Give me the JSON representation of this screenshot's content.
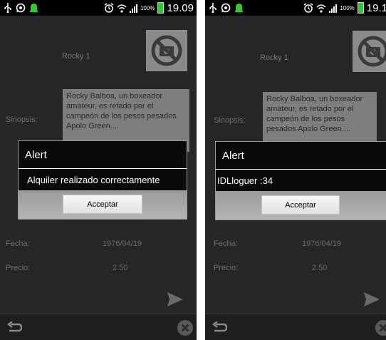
{
  "screens": [
    {
      "status": {
        "clock": "19.09",
        "battery_pct": "100%"
      },
      "movie_title": "Rocky 1",
      "synopsis_label": "Sinopsis:",
      "synopsis_text": "Rocky Balboa, un boxeador amateur, es retado por el campeón de los pesos pesados Apolo Green....",
      "fecha_label": "Fecha:",
      "fecha_value": "1976/04/19",
      "precio_label": "Precio:",
      "precio_value": "2.50",
      "dialog": {
        "title": "Alert",
        "message": "Alquiler realizado correctamente",
        "button": "Acceptar"
      }
    },
    {
      "status": {
        "clock": "19.1",
        "battery_pct": "100%"
      },
      "movie_title": "Rocky 1",
      "synopsis_label": "Sinopsis:",
      "synopsis_text": "Rocky Balboa, un boxeador amateur, es retado por el campeón de los pesos pesados Apolo Green....",
      "fecha_label": "Fecha:",
      "fecha_value": "1976/04/19",
      "precio_label": "Precio:",
      "precio_value": "2.50",
      "dialog": {
        "title": "Alert",
        "message": "IDLloguer :34",
        "button": "Acceptar"
      }
    }
  ],
  "colors": {
    "battery": "#2ecc2e",
    "dialog_bg": "#0a0a0a",
    "screen_bg": "#262626"
  },
  "icons": [
    "usb-icon",
    "whatsapp-icon",
    "notification-icon",
    "alarm-icon",
    "wifi-icon",
    "signal-icon",
    "battery-icon",
    "no-photo-icon",
    "send-icon",
    "back-icon",
    "close-icon"
  ]
}
